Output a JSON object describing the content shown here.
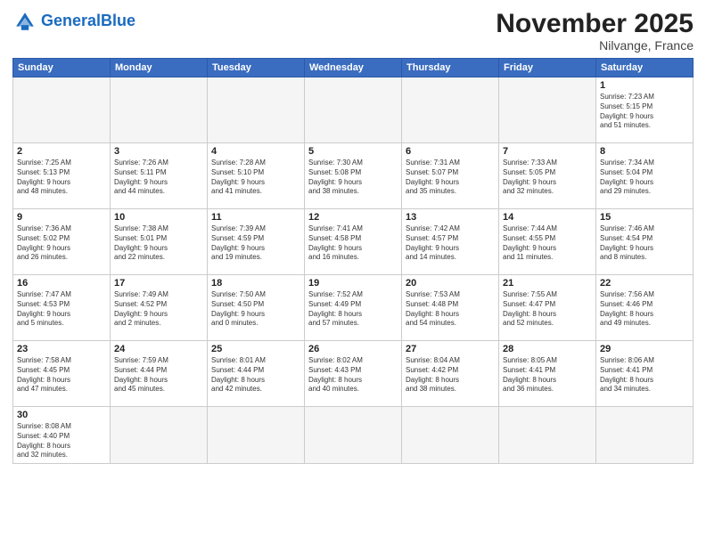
{
  "header": {
    "logo_general": "General",
    "logo_blue": "Blue",
    "month_title": "November 2025",
    "location": "Nilvange, France"
  },
  "weekdays": [
    "Sunday",
    "Monday",
    "Tuesday",
    "Wednesday",
    "Thursday",
    "Friday",
    "Saturday"
  ],
  "days": {
    "d1": {
      "num": "1",
      "info": "Sunrise: 7:23 AM\nSunset: 5:15 PM\nDaylight: 9 hours\nand 51 minutes."
    },
    "d2": {
      "num": "2",
      "info": "Sunrise: 7:25 AM\nSunset: 5:13 PM\nDaylight: 9 hours\nand 48 minutes."
    },
    "d3": {
      "num": "3",
      "info": "Sunrise: 7:26 AM\nSunset: 5:11 PM\nDaylight: 9 hours\nand 44 minutes."
    },
    "d4": {
      "num": "4",
      "info": "Sunrise: 7:28 AM\nSunset: 5:10 PM\nDaylight: 9 hours\nand 41 minutes."
    },
    "d5": {
      "num": "5",
      "info": "Sunrise: 7:30 AM\nSunset: 5:08 PM\nDaylight: 9 hours\nand 38 minutes."
    },
    "d6": {
      "num": "6",
      "info": "Sunrise: 7:31 AM\nSunset: 5:07 PM\nDaylight: 9 hours\nand 35 minutes."
    },
    "d7": {
      "num": "7",
      "info": "Sunrise: 7:33 AM\nSunset: 5:05 PM\nDaylight: 9 hours\nand 32 minutes."
    },
    "d8": {
      "num": "8",
      "info": "Sunrise: 7:34 AM\nSunset: 5:04 PM\nDaylight: 9 hours\nand 29 minutes."
    },
    "d9": {
      "num": "9",
      "info": "Sunrise: 7:36 AM\nSunset: 5:02 PM\nDaylight: 9 hours\nand 26 minutes."
    },
    "d10": {
      "num": "10",
      "info": "Sunrise: 7:38 AM\nSunset: 5:01 PM\nDaylight: 9 hours\nand 22 minutes."
    },
    "d11": {
      "num": "11",
      "info": "Sunrise: 7:39 AM\nSunset: 4:59 PM\nDaylight: 9 hours\nand 19 minutes."
    },
    "d12": {
      "num": "12",
      "info": "Sunrise: 7:41 AM\nSunset: 4:58 PM\nDaylight: 9 hours\nand 16 minutes."
    },
    "d13": {
      "num": "13",
      "info": "Sunrise: 7:42 AM\nSunset: 4:57 PM\nDaylight: 9 hours\nand 14 minutes."
    },
    "d14": {
      "num": "14",
      "info": "Sunrise: 7:44 AM\nSunset: 4:55 PM\nDaylight: 9 hours\nand 11 minutes."
    },
    "d15": {
      "num": "15",
      "info": "Sunrise: 7:46 AM\nSunset: 4:54 PM\nDaylight: 9 hours\nand 8 minutes."
    },
    "d16": {
      "num": "16",
      "info": "Sunrise: 7:47 AM\nSunset: 4:53 PM\nDaylight: 9 hours\nand 5 minutes."
    },
    "d17": {
      "num": "17",
      "info": "Sunrise: 7:49 AM\nSunset: 4:52 PM\nDaylight: 9 hours\nand 2 minutes."
    },
    "d18": {
      "num": "18",
      "info": "Sunrise: 7:50 AM\nSunset: 4:50 PM\nDaylight: 9 hours\nand 0 minutes."
    },
    "d19": {
      "num": "19",
      "info": "Sunrise: 7:52 AM\nSunset: 4:49 PM\nDaylight: 8 hours\nand 57 minutes."
    },
    "d20": {
      "num": "20",
      "info": "Sunrise: 7:53 AM\nSunset: 4:48 PM\nDaylight: 8 hours\nand 54 minutes."
    },
    "d21": {
      "num": "21",
      "info": "Sunrise: 7:55 AM\nSunset: 4:47 PM\nDaylight: 8 hours\nand 52 minutes."
    },
    "d22": {
      "num": "22",
      "info": "Sunrise: 7:56 AM\nSunset: 4:46 PM\nDaylight: 8 hours\nand 49 minutes."
    },
    "d23": {
      "num": "23",
      "info": "Sunrise: 7:58 AM\nSunset: 4:45 PM\nDaylight: 8 hours\nand 47 minutes."
    },
    "d24": {
      "num": "24",
      "info": "Sunrise: 7:59 AM\nSunset: 4:44 PM\nDaylight: 8 hours\nand 45 minutes."
    },
    "d25": {
      "num": "25",
      "info": "Sunrise: 8:01 AM\nSunset: 4:44 PM\nDaylight: 8 hours\nand 42 minutes."
    },
    "d26": {
      "num": "26",
      "info": "Sunrise: 8:02 AM\nSunset: 4:43 PM\nDaylight: 8 hours\nand 40 minutes."
    },
    "d27": {
      "num": "27",
      "info": "Sunrise: 8:04 AM\nSunset: 4:42 PM\nDaylight: 8 hours\nand 38 minutes."
    },
    "d28": {
      "num": "28",
      "info": "Sunrise: 8:05 AM\nSunset: 4:41 PM\nDaylight: 8 hours\nand 36 minutes."
    },
    "d29": {
      "num": "29",
      "info": "Sunrise: 8:06 AM\nSunset: 4:41 PM\nDaylight: 8 hours\nand 34 minutes."
    },
    "d30": {
      "num": "30",
      "info": "Sunrise: 8:08 AM\nSunset: 4:40 PM\nDaylight: 8 hours\nand 32 minutes."
    }
  }
}
